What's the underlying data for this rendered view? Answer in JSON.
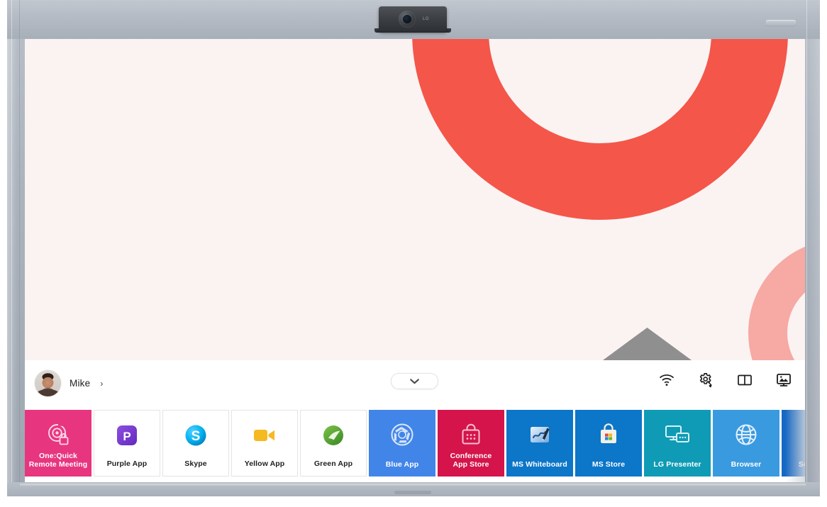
{
  "device": {
    "type": "interactive-display-board",
    "webcam_brand": "LG",
    "bezel_color": "#aab2bc"
  },
  "wallpaper": {
    "background_color": "#fbf3f2",
    "shapes": [
      {
        "name": "red-ring",
        "color": "#f4564a"
      },
      {
        "name": "pink-ring",
        "color": "#f7a9a4"
      },
      {
        "name": "grey-triangle",
        "color": "#8f8f8f"
      }
    ]
  },
  "taskbar": {
    "user": {
      "name": "Mike",
      "chevron": "›"
    },
    "expand_toggle": {
      "label": "ⱟ",
      "name": "expand-taskbar"
    },
    "system_icons": [
      {
        "name": "wifi-icon",
        "label": "Wi-Fi"
      },
      {
        "name": "settings-icon",
        "label": "Settings"
      },
      {
        "name": "split-screen-icon",
        "label": "Split Screen"
      },
      {
        "name": "display-input-icon",
        "label": "Display"
      }
    ]
  },
  "tiles": [
    {
      "label": "One:Quick\nRemote Meeting",
      "label_line1": "One:Quick",
      "label_line2": "Remote Meeting",
      "style": "colored",
      "bg": "#e8357f",
      "icon": "one-quick-icon",
      "name": "tile-one-quick-remote-meeting"
    },
    {
      "label": "Purple App",
      "style": "light",
      "bg": "#ffffff",
      "icon": "purple-app-icon",
      "icon_color": "#7b3fd4",
      "name": "tile-purple-app"
    },
    {
      "label": "Skype",
      "style": "light",
      "bg": "#ffffff",
      "icon": "skype-icon",
      "icon_color": "#00aff0",
      "name": "tile-skype"
    },
    {
      "label": "Yellow App",
      "style": "light",
      "bg": "#ffffff",
      "icon": "video-camera-icon",
      "icon_color": "#f5b921",
      "name": "tile-yellow-app"
    },
    {
      "label": "Green App",
      "style": "light",
      "bg": "#ffffff",
      "icon": "green-globe-icon",
      "icon_color": "#5aa63c",
      "name": "tile-green-app"
    },
    {
      "label": "Blue App",
      "style": "colored",
      "bg": "#4285e8",
      "icon": "camera-aperture-icon",
      "name": "tile-blue-app"
    },
    {
      "label": "Conference\nApp Store",
      "label_line1": "Conference",
      "label_line2": "App Store",
      "style": "colored",
      "bg": "#d4144a",
      "icon": "shopping-bag-icon",
      "name": "tile-conference-app-store"
    },
    {
      "label": "MS Whiteboard",
      "style": "colored",
      "bg": "#0c76c8",
      "icon": "whiteboard-pen-icon",
      "name": "tile-ms-whiteboard"
    },
    {
      "label": "MS Store",
      "style": "colored",
      "bg": "#0c76c8",
      "icon": "ms-store-bag-icon",
      "name": "tile-ms-store"
    },
    {
      "label": "LG Presenter",
      "style": "colored",
      "bg": "#0f9bb5",
      "icon": "screen-share-icon",
      "name": "tile-lg-presenter"
    },
    {
      "label": "Browser",
      "style": "colored",
      "bg": "#3a9ae0",
      "icon": "globe-icon",
      "name": "tile-browser"
    },
    {
      "label": "Screen C",
      "style": "colored",
      "bg": "#1568c4",
      "icon": "screen-capture-icon",
      "name": "tile-screen-capture"
    }
  ]
}
